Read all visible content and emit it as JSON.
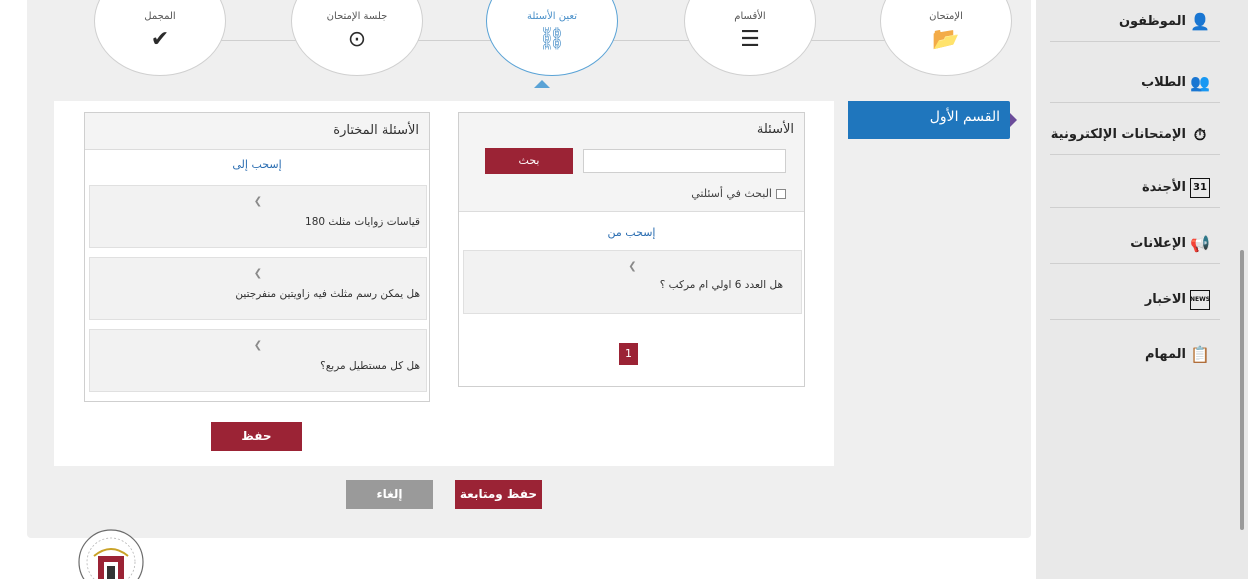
{
  "wizard": {
    "steps": [
      {
        "label": "المجمل",
        "icon": "check-icon"
      },
      {
        "label": "جلسة الإمتحان",
        "icon": "clock-icon"
      },
      {
        "label": "تعين الأسئلة",
        "icon": "link-icon"
      },
      {
        "label": "الأقسام",
        "icon": "list-icon"
      },
      {
        "label": "الإمتحان",
        "icon": "folder-open-icon"
      }
    ],
    "active_step": 2
  },
  "sidebar": {
    "items": [
      {
        "label": "الموظفون",
        "icon": "employee-icon"
      },
      {
        "label": "الطلاب",
        "icon": "students-icon"
      },
      {
        "label": "الإمتحانات الإلكترونية",
        "icon": "exam-clock-icon"
      },
      {
        "label": "الأجندة",
        "icon": "calendar-icon",
        "badge": "31"
      },
      {
        "label": "الإعلانات",
        "icon": "megaphone-icon"
      },
      {
        "label": "الاخبار",
        "icon": "news-icon",
        "badge": "NEWS"
      },
      {
        "label": "المهام",
        "icon": "clipboard-icon"
      }
    ]
  },
  "section_tab": {
    "label": "القسم الأول"
  },
  "selected_questions": {
    "title": "الأسئلة المختارة",
    "drag_to": "إسحب إلى",
    "items": [
      "قياسات زوايات مثلث 180",
      "هل يمكن رسم مثلث فيه زاويتين منفرجتين",
      "هل كل مستطيل مربع؟"
    ]
  },
  "questions_pool": {
    "title": "الأسئلة",
    "search_button": "بحث",
    "search_value": "",
    "own_questions_label": "البحث في أسئلتي",
    "drag_from": "إسحب من",
    "items": [
      "هل العدد 6 اولي ام مركب ؟"
    ],
    "page": "1"
  },
  "buttons": {
    "save": "حفظ",
    "save_continue": "حفظ ومتابعة",
    "cancel": "إلغاء"
  },
  "colors": {
    "accent_red": "#9b2335",
    "active_blue": "#1f76bd",
    "link_blue": "#2a6db1"
  }
}
